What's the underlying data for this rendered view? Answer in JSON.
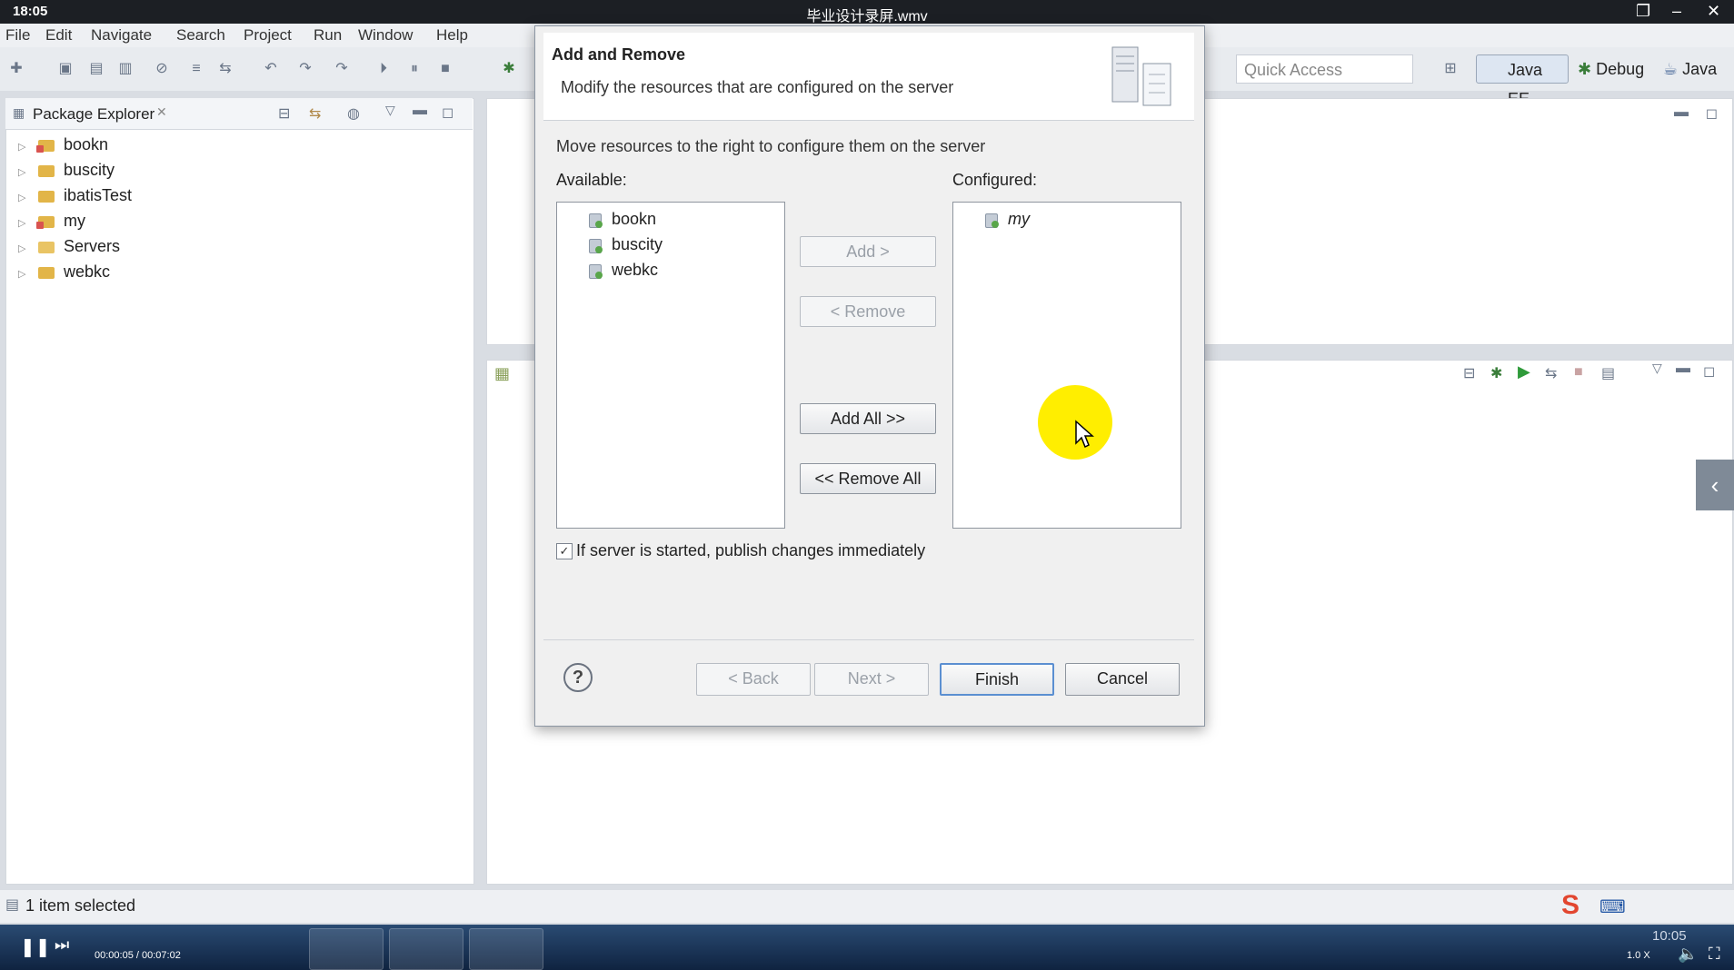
{
  "titlebar": {
    "time": "18:05",
    "title": "毕业设计录屏.wmv"
  },
  "menubar": {
    "items": [
      "File",
      "Edit",
      "Navigate",
      "Search",
      "Project",
      "Run",
      "Window",
      "Help"
    ]
  },
  "toolbar": {
    "quick_access_placeholder": "Quick Access",
    "perspectives": [
      "Java EE",
      "Debug",
      "Java"
    ]
  },
  "package_explorer": {
    "tab_label": "Package Explorer",
    "items": [
      {
        "label": "bookn",
        "icon": "project-error-icon"
      },
      {
        "label": "buscity",
        "icon": "project-icon"
      },
      {
        "label": "ibatisTest",
        "icon": "project-icon"
      },
      {
        "label": "my",
        "icon": "project-error-icon"
      },
      {
        "label": "Servers",
        "icon": "folder-icon"
      },
      {
        "label": "webkc",
        "icon": "project-icon"
      }
    ]
  },
  "dialog": {
    "title": "Add and Remove",
    "description": "Modify the resources that are configured on the server",
    "instruction": "Move resources to the right to configure them on the server",
    "available_label": "Available:",
    "configured_label": "Configured:",
    "available": [
      "bookn",
      "buscity",
      "webkc"
    ],
    "configured": [
      "my"
    ],
    "buttons": {
      "add": "Add >",
      "remove": "< Remove",
      "add_all": "Add All >>",
      "remove_all": "<< Remove All",
      "back": "< Back",
      "next": "Next >",
      "finish": "Finish",
      "cancel": "Cancel"
    },
    "publish_checkbox": {
      "label": "If server is started, publish changes immediately",
      "checked": true
    }
  },
  "statusbar": {
    "text": "1 item selected"
  },
  "taskbar": {
    "video_time": "00:00:05 / 00:07:02",
    "clock": "10:05",
    "speed": "1.0 X"
  },
  "colors": {
    "accent": "#5b8fd1",
    "cursor_highlight": "#ffee00"
  }
}
